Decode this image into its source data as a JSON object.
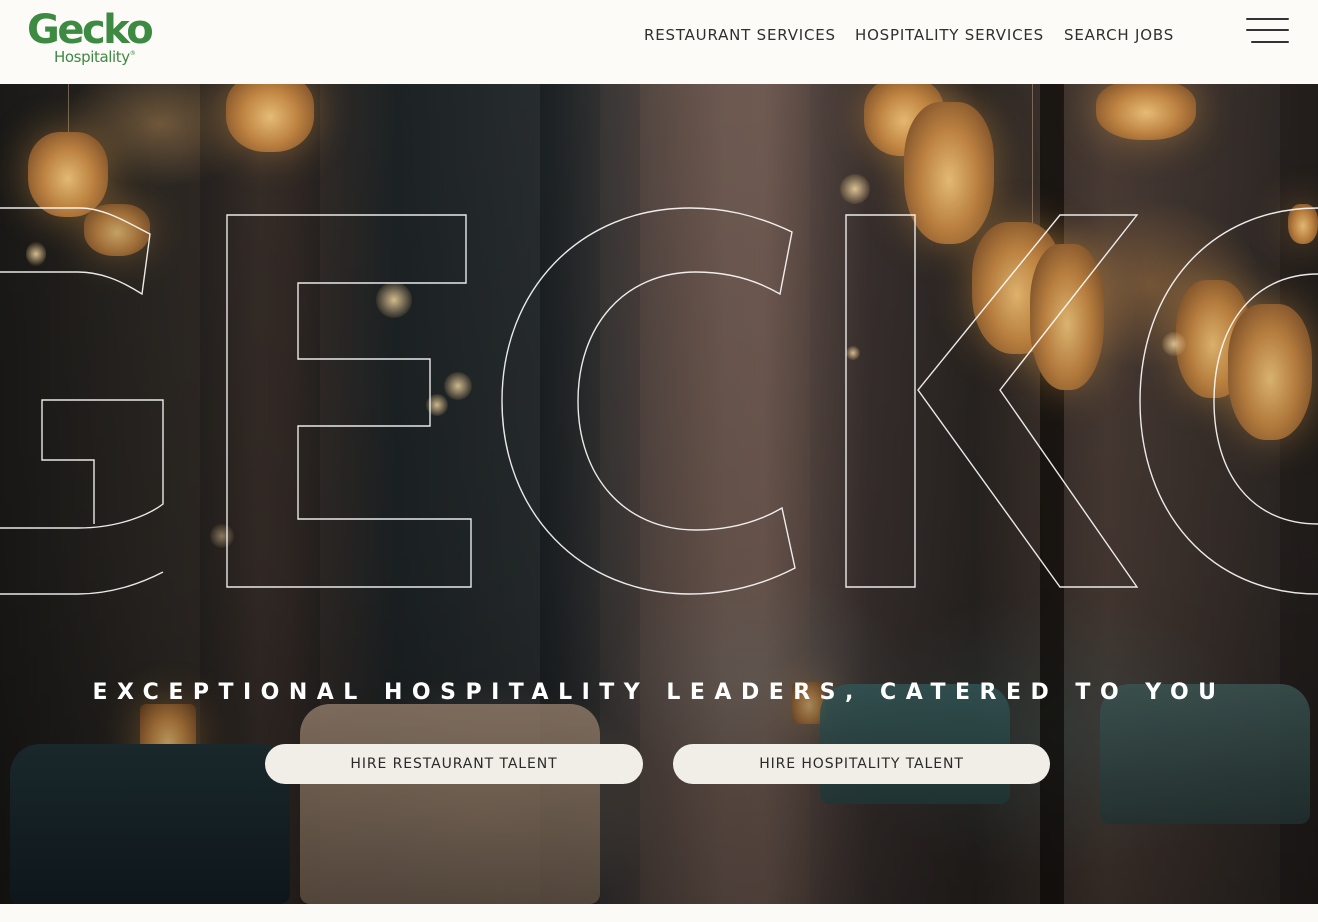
{
  "brand": {
    "name": "Gecko",
    "sub": "Hospitality",
    "mark": "®",
    "color": "#3d8a43"
  },
  "nav": {
    "items": [
      {
        "label": "RESTAURANT SERVICES"
      },
      {
        "label": "HOSPITALITY SERVICES"
      },
      {
        "label": "SEARCH JOBS"
      }
    ],
    "menu_icon": "hamburger-menu-icon"
  },
  "hero": {
    "outline_word": "GECKO",
    "tagline": "EXCEPTIONAL HOSPITALITY LEADERS, CATERED TO YOU",
    "buttons": [
      {
        "label": "HIRE RESTAURANT TALENT"
      },
      {
        "label": "HIRE HOSPITALITY TALENT"
      }
    ],
    "button_color": "#f1eee8"
  }
}
